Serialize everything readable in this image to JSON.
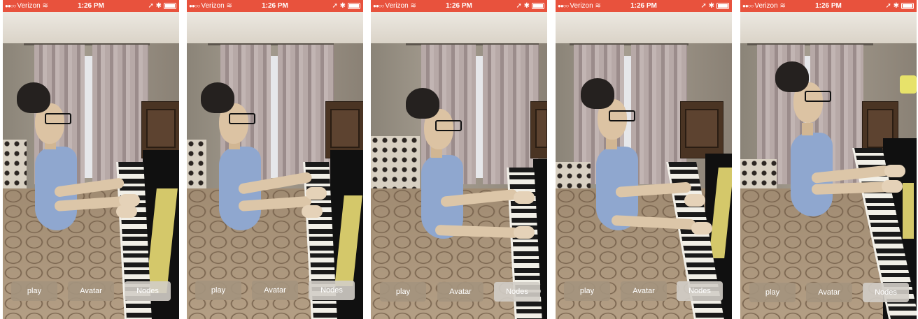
{
  "status_bar": {
    "carrier": "Verizon",
    "time": "1:26 PM",
    "icons": [
      "signal-icon",
      "wifi-icon",
      "location-icon",
      "bluetooth-icon",
      "battery-icon"
    ]
  },
  "buttons": {
    "play": "play",
    "avatar": "Avatar",
    "nodes": "Nodes"
  },
  "colors": {
    "status_bar": "#e8523d",
    "button_bg": "#a4947e",
    "nodes_button_bg": "#d2cdc6"
  }
}
